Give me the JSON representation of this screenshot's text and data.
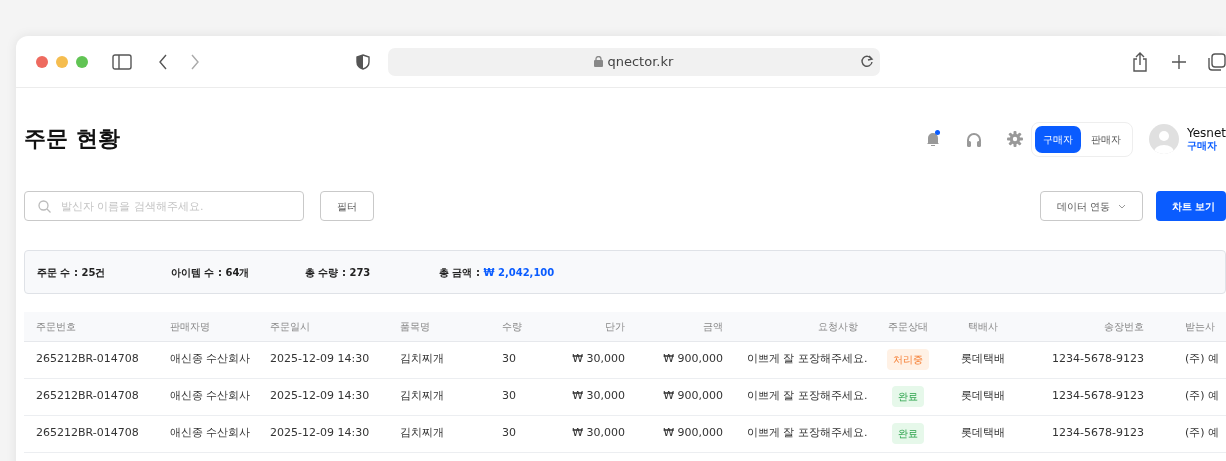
{
  "browser": {
    "address": "qnector.kr"
  },
  "page": {
    "title": "주문 현황"
  },
  "header": {
    "notification_dot": true,
    "roles": [
      {
        "label": "구매자",
        "selected": true
      },
      {
        "label": "판매자",
        "selected": false
      }
    ],
    "user": {
      "name": "Yesnet",
      "role": "구매자"
    }
  },
  "toolbar": {
    "search": {
      "placeholder": "발신자 이름을 검색해주세요."
    },
    "filter_button": "필터",
    "data_link_button": "데이터 연동",
    "chart_button": "차트 보기"
  },
  "summary": [
    {
      "label": "주문 수 : ",
      "value": "25건",
      "highlight": false
    },
    {
      "label": "아이템 수 : ",
      "value": "64개",
      "highlight": false
    },
    {
      "label": "총 수량 : ",
      "value": "273",
      "highlight": false
    },
    {
      "label": "총 금액 : ",
      "value": "₩ 2,042,100",
      "highlight": true
    }
  ],
  "table": {
    "columns": [
      "주문번호",
      "판매자명",
      "주문일시",
      "품목명",
      "수량",
      "단가",
      "금액",
      "요청사항",
      "주문상태",
      "택배사",
      "송장번호",
      "받는사"
    ],
    "rows": [
      {
        "order_no": "265212BR-014708",
        "seller": "애신종 수산회사",
        "date": "2025-12-09 14:30",
        "item": "김치찌개",
        "qty": "30",
        "unit_price": "₩ 30,000",
        "amount": "₩ 900,000",
        "request": "이쁘게 잘 포장해주세요.",
        "status": {
          "label": "처리중",
          "kind": "processing"
        },
        "courier": "롯데택배",
        "tracking": "1234-5678-9123",
        "recipient": "(주) 예"
      },
      {
        "order_no": "265212BR-014708",
        "seller": "애신종 수산회사",
        "date": "2025-12-09 14:30",
        "item": "김치찌개",
        "qty": "30",
        "unit_price": "₩ 30,000",
        "amount": "₩ 900,000",
        "request": "이쁘게 잘 포장해주세요.",
        "status": {
          "label": "완료",
          "kind": "done"
        },
        "courier": "롯데택배",
        "tracking": "1234-5678-9123",
        "recipient": "(주) 예"
      },
      {
        "order_no": "265212BR-014708",
        "seller": "애신종 수산회사",
        "date": "2025-12-09 14:30",
        "item": "김치찌개",
        "qty": "30",
        "unit_price": "₩ 30,000",
        "amount": "₩ 900,000",
        "request": "이쁘게 잘 포장해주세요.",
        "status": {
          "label": "완료",
          "kind": "done"
        },
        "courier": "롯데택배",
        "tracking": "1234-5678-9123",
        "recipient": "(주) 예"
      }
    ]
  }
}
